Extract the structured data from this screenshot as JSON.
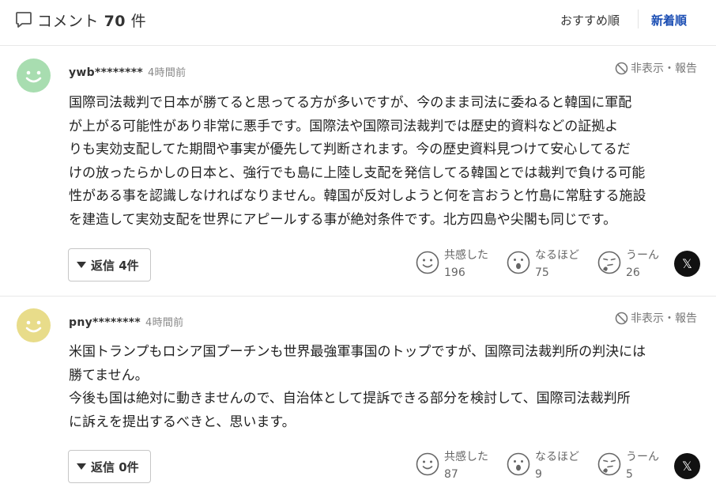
{
  "header": {
    "icon": "comment-bubble-icon",
    "title_prefix": "コメント",
    "count": "70",
    "title_suffix": "件",
    "sort_recommended": "おすすめ順",
    "sort_newest": "新着順",
    "active_sort_color": "#1a4db3"
  },
  "comments": [
    {
      "username": "ywb********",
      "time": "4時間前",
      "report_label": "非表示・報告",
      "avatar_color": "#a8ddb0",
      "text": "国際司法裁判で日本が勝てると思ってる方が多いですが、今のまま司法に委ねると韓国に軍配\nが上がる可能性があり非常に悪手です。国際法や国際司法裁判では歴史的資料などの証拠よ\nりも実効支配してた期間や事実が優先して判断されます。今の歴史資料見つけて安心してるだ\nけの放ったらかしの日本と、強行でも島に上陸し支配を発信してる韓国とでは裁判で負ける可能\n性がある事を認識しなければなりません。韓国が反対しようと何を言おうと竹島に常駐する施設\nを建造して実効支配を世界にアピールする事が絶対条件です。北方四島や尖閣も同じです。",
      "reply_label": "返信 4件",
      "reactions": [
        {
          "label": "共感した",
          "count": "196",
          "icon": "smile-face-icon"
        },
        {
          "label": "なるほど",
          "count": "75",
          "icon": "surprised-face-icon"
        },
        {
          "label": "うーん",
          "count": "26",
          "icon": "thinking-face-icon"
        }
      ],
      "share_icon": "x-logo-icon"
    },
    {
      "username": "pny********",
      "time": "4時間前",
      "report_label": "非表示・報告",
      "avatar_color": "#e8dc8a",
      "text": "米国トランプもロシア国プーチンも世界最強軍事国のトップですが、国際司法裁判所の判決には\n勝てません。\n今後も国は絶対に動きませんので、自治体として提訴できる部分を検討して、国際司法裁判所\nに訴えを提出するべきと、思います。",
      "reply_label": "返信 0件",
      "reactions": [
        {
          "label": "共感した",
          "count": "87",
          "icon": "smile-face-icon"
        },
        {
          "label": "なるほど",
          "count": "9",
          "icon": "surprised-face-icon"
        },
        {
          "label": "うーん",
          "count": "5",
          "icon": "thinking-face-icon"
        }
      ],
      "share_icon": "x-logo-icon"
    }
  ]
}
